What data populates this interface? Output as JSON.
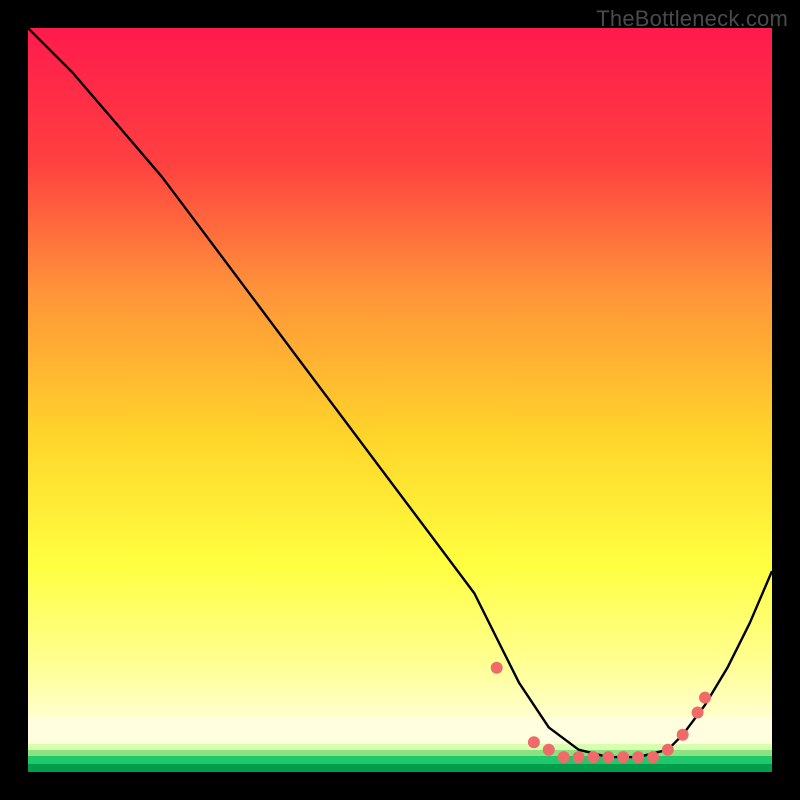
{
  "watermark": "TheBottleneck.com",
  "chart_data": {
    "type": "line",
    "title": "",
    "xlabel": "",
    "ylabel": "",
    "xlim": [
      0,
      100
    ],
    "ylim": [
      0,
      100
    ],
    "grid": false,
    "background_gradient": {
      "top": "#ff1a4d",
      "mid1": "#ff6a2b",
      "mid2": "#ffd928",
      "low": "#ffff80",
      "band_light": "#ffffbf",
      "green": "#00e676",
      "dark_green": "#009e4a"
    },
    "series": [
      {
        "name": "bottleneck-curve",
        "stroke": "#000000",
        "x": [
          0,
          6,
          12,
          18,
          24,
          30,
          36,
          42,
          48,
          54,
          60,
          63,
          66,
          70,
          74,
          78,
          82,
          86,
          88,
          91,
          94,
          97,
          100
        ],
        "y": [
          100,
          94,
          87,
          80,
          72,
          64,
          56,
          48,
          40,
          32,
          24,
          18,
          12,
          6,
          3,
          2,
          2,
          3,
          5,
          9,
          14,
          20,
          27
        ]
      }
    ],
    "markers": {
      "name": "highlight-points",
      "fill": "#f06a6a",
      "radius": 6,
      "x": [
        63,
        68,
        70,
        72,
        74,
        76,
        78,
        80,
        82,
        84,
        86,
        88,
        90,
        91
      ],
      "y": [
        14,
        4,
        3,
        2,
        2,
        2,
        2,
        2,
        2,
        2,
        3,
        5,
        8,
        10
      ]
    }
  }
}
